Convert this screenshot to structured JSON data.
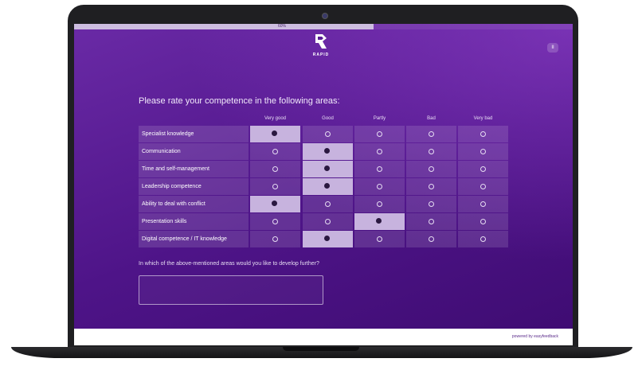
{
  "progress": {
    "label": "60%",
    "value_percent": 60
  },
  "brand": {
    "logo_text": "RAPID"
  },
  "controls": {
    "pause_label": "II"
  },
  "survey": {
    "title": "Please rate your competence in the following areas:",
    "columns": [
      "Very good",
      "Good",
      "Partly",
      "Bad",
      "Very bad"
    ],
    "rows": [
      {
        "label": "Specialist knowledge",
        "selected_column": "Very good"
      },
      {
        "label": "Communication",
        "selected_column": "Good"
      },
      {
        "label": "Time and self-management",
        "selected_column": "Good"
      },
      {
        "label": "Leadership competence",
        "selected_column": "Good"
      },
      {
        "label": "Ability to deal with conflict",
        "selected_column": "Very good"
      },
      {
        "label": "Presentation skills",
        "selected_column": "Partly"
      },
      {
        "label": "Digital competence / IT knowledge",
        "selected_column": "Good"
      }
    ],
    "question2": "In which of the above-mentioned areas would you like to develop further?",
    "answer2_value": ""
  },
  "footer": {
    "powered_by": "powered by easyfeedback"
  },
  "colors": {
    "accent": "#4e1488",
    "selected_cell": "#c7b3de"
  }
}
